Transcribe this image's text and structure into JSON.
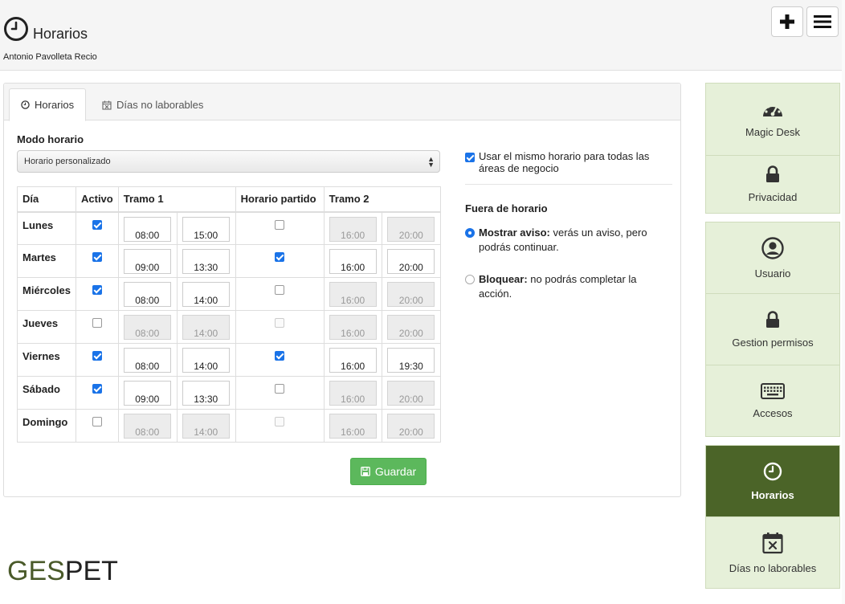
{
  "header": {
    "title": "Horarios",
    "subtitle": "Antonio Pavolleta Recio",
    "add_icon": "plus-icon",
    "menu_icon": "hamburger-menu-icon"
  },
  "tabs": [
    {
      "label": "Horarios",
      "icon": "clock-icon",
      "active": true
    },
    {
      "label": "Días no laborables",
      "icon": "calendar-x-icon",
      "active": false
    }
  ],
  "form": {
    "modo_label": "Modo horario",
    "modo_value": "Horario personalizado",
    "columns": [
      "Día",
      "Activo",
      "Tramo 1",
      "Horario partido",
      "Tramo 2"
    ],
    "rows": [
      {
        "day": "Lunes",
        "active": true,
        "t1_start": "08:00",
        "t1_end": "15:00",
        "split": false,
        "t2_start": "16:00",
        "t2_end": "20:00"
      },
      {
        "day": "Martes",
        "active": true,
        "t1_start": "09:00",
        "t1_end": "13:30",
        "split": true,
        "t2_start": "16:00",
        "t2_end": "20:00"
      },
      {
        "day": "Miércoles",
        "active": true,
        "t1_start": "08:00",
        "t1_end": "14:00",
        "split": false,
        "t2_start": "16:00",
        "t2_end": "20:00"
      },
      {
        "day": "Jueves",
        "active": false,
        "t1_start": "08:00",
        "t1_end": "14:00",
        "split": false,
        "t2_start": "16:00",
        "t2_end": "20:00"
      },
      {
        "day": "Viernes",
        "active": true,
        "t1_start": "08:00",
        "t1_end": "14:00",
        "split": true,
        "t2_start": "16:00",
        "t2_end": "19:30"
      },
      {
        "day": "Sábado",
        "active": true,
        "t1_start": "09:00",
        "t1_end": "13:30",
        "split": false,
        "t2_start": "16:00",
        "t2_end": "20:00"
      },
      {
        "day": "Domingo",
        "active": false,
        "t1_start": "08:00",
        "t1_end": "14:00",
        "split": false,
        "t2_start": "16:00",
        "t2_end": "20:00"
      }
    ],
    "save_label": "Guardar"
  },
  "options": {
    "same_schedule_label": "Usar el mismo horario para todas las áreas de negocio",
    "same_schedule_checked": true,
    "fuera_label": "Fuera de horario",
    "mostrar_bold": "Mostrar aviso:",
    "mostrar_text": "verás un aviso, pero podrás continuar.",
    "bloquear_bold": "Bloquear:",
    "bloquear_text": "no podrás completar la acción.",
    "selected": "mostrar"
  },
  "brand": {
    "left": "GES",
    "right": "PET"
  },
  "sidebar": {
    "group1": [
      {
        "label": "Magic Desk",
        "icon": "gauge-icon"
      },
      {
        "label": "Privacidad",
        "icon": "lock-icon"
      }
    ],
    "group2": [
      {
        "label": "Usuario",
        "icon": "user-circle-icon"
      },
      {
        "label": "Gestion permisos",
        "icon": "lock-icon"
      },
      {
        "label": "Accesos",
        "icon": "keyboard-icon"
      }
    ],
    "group3": [
      {
        "label": "Horarios",
        "icon": "clock-icon",
        "active": true
      },
      {
        "label": "Días no laborables",
        "icon": "calendar-x-icon",
        "active": false
      }
    ]
  },
  "colors": {
    "accent_green": "#4b6428",
    "sidebar_bg": "#e6f0d9",
    "save_green": "#5cb85c",
    "checkbox_blue": "#1a73e8"
  }
}
